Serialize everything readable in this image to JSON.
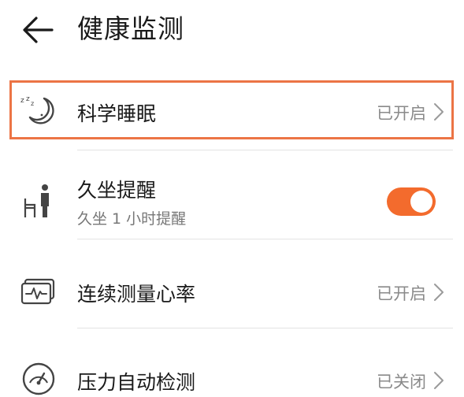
{
  "header": {
    "title": "健康监测",
    "back_icon": "arrow-left-icon"
  },
  "rows": [
    {
      "label": "科学睡眠",
      "status": "已开启",
      "icon": "sleep-moon-icon",
      "highlighted": true
    },
    {
      "label": "久坐提醒",
      "sublabel": "久坐 1 小时提醒",
      "icon": "sedentary-person-icon",
      "toggle_on": true
    },
    {
      "label": "连续测量心率",
      "status": "已开启",
      "icon": "heart-rate-monitor-icon"
    },
    {
      "label": "压力自动检测",
      "status": "已关闭",
      "icon": "pressure-gauge-icon"
    }
  ],
  "colors": {
    "accent": "#f36b2d",
    "highlight_border": "#ec7445",
    "text_primary": "#1a1a1a",
    "text_secondary": "#8a8a8a",
    "divider": "#e3e3e3"
  }
}
